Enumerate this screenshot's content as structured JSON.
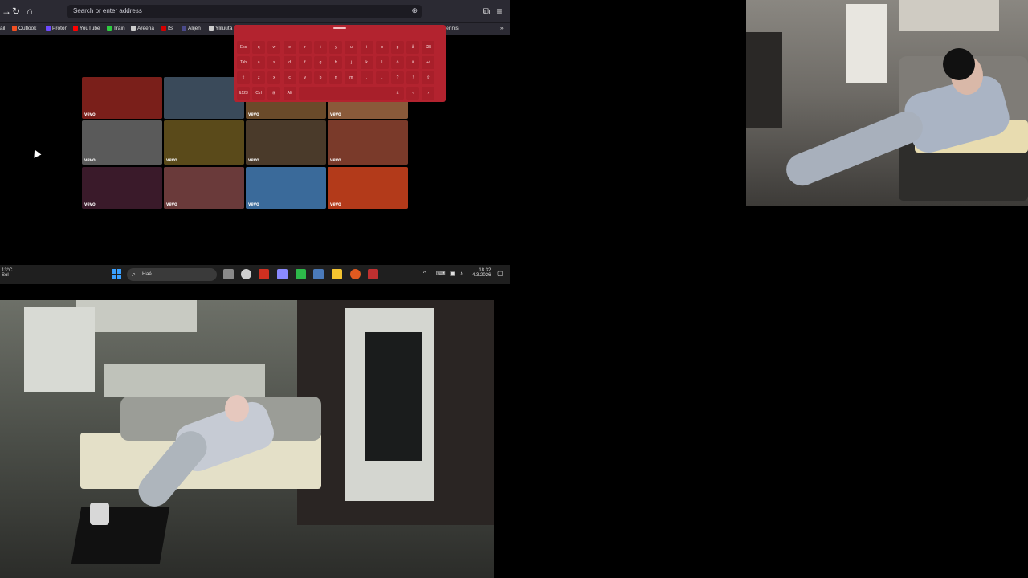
{
  "browser": {
    "url_placeholder": "Search or enter address",
    "bookmarks": [
      {
        "label": "ail",
        "color": "#2b2a33"
      },
      {
        "label": "Outlook",
        "color": "#f25022"
      },
      {
        "label": "Proton",
        "color": "#6d4aff"
      },
      {
        "label": "YouTube",
        "color": "#ff0000"
      },
      {
        "label": "Train",
        "color": "#2ecc40"
      },
      {
        "label": "Areena",
        "color": "#cccccc"
      },
      {
        "label": "IS",
        "color": "#d40000"
      },
      {
        "label": "Alijen",
        "color": "#4a4a8a"
      },
      {
        "label": "Yliluuta",
        "color": "#cccccc"
      },
      {
        "label": "Tennis",
        "color": "#e03030"
      }
    ],
    "thumbnails": [
      {
        "badge": "vevo",
        "color": "#7a1f1a"
      },
      {
        "badge": "",
        "color": "#3a4a5a"
      },
      {
        "badge": "vevo",
        "color": "#6a4a2a"
      },
      {
        "badge": "vevo",
        "color": "#8a5a3a"
      },
      {
        "badge": "vevo",
        "color": "#5a5a5a"
      },
      {
        "badge": "vevo",
        "color": "#5a4a1a"
      },
      {
        "badge": "vevo",
        "color": "#4a3a2a"
      },
      {
        "badge": "vevo",
        "color": "#7a3a2a"
      },
      {
        "badge": "vevo",
        "color": "#3a1a2a"
      },
      {
        "badge": "vevo",
        "color": "#6a3a3a"
      },
      {
        "badge": "vevo",
        "color": "#3a6a9a"
      },
      {
        "badge": "vevo",
        "color": "#b33a1a"
      }
    ]
  },
  "keyboard": {
    "rows": [
      [
        "Esc",
        "q",
        "w",
        "e",
        "r",
        "t",
        "y",
        "u",
        "i",
        "o",
        "p",
        "å",
        "⌫"
      ],
      [
        "Tab",
        "a",
        "s",
        "d",
        "f",
        "g",
        "h",
        "j",
        "k",
        "l",
        "ö",
        "ä",
        "↵"
      ],
      [
        "⇧",
        "z",
        "x",
        "c",
        "v",
        "b",
        "n",
        "m",
        ",",
        ".",
        "?",
        "!",
        "⇧"
      ],
      [
        "&123",
        "Ctrl",
        "⊞",
        "Alt",
        "",
        "",
        "",
        "",
        "",
        "",
        "ä",
        "‹",
        "›"
      ]
    ]
  },
  "taskbar": {
    "weather_temp": "13°C",
    "weather_desc": "Sol",
    "search_label": "Haé",
    "time": "18.32",
    "date": "4.3.2026",
    "apps": [
      "#8a8a8a",
      "#cfcfcf",
      "#d03020",
      "#8a8aff",
      "#2db84a",
      "#4a7aba",
      "#f4c430",
      "#e05a20",
      "#c03030"
    ]
  }
}
